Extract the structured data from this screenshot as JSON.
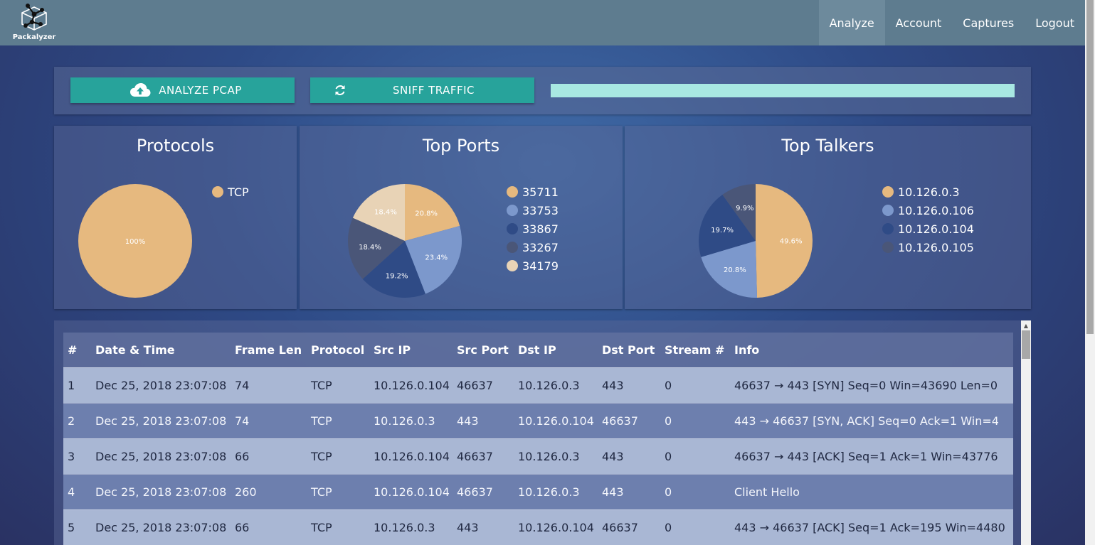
{
  "app": {
    "logo_text": "Packalyzer"
  },
  "nav": {
    "items": [
      {
        "label": "Analyze",
        "active": true
      },
      {
        "label": "Account"
      },
      {
        "label": "Captures"
      },
      {
        "label": "Logout"
      }
    ]
  },
  "actions": {
    "analyze_label": "ANALYZE PCAP",
    "analyze_icon": "cloud-upload-icon",
    "sniff_label": "SNIFF TRAFFIC",
    "sniff_icon": "refresh-icon",
    "progress": 1.0,
    "accent": "#27a39b"
  },
  "charts": {
    "protocols": {
      "title": "Protocols"
    },
    "ports": {
      "title": "Top Ports"
    },
    "talkers": {
      "title": "Top Talkers"
    }
  },
  "chart_data": [
    {
      "type": "pie",
      "title": "Protocols",
      "categories": [
        "TCP"
      ],
      "values": [
        100
      ],
      "labels": [
        "100%"
      ],
      "colors": [
        "#e6b97f"
      ],
      "legend": "right"
    },
    {
      "type": "pie",
      "title": "Top Ports",
      "categories": [
        "35711",
        "33753",
        "33867",
        "33267",
        "34179"
      ],
      "values": [
        20.8,
        23.4,
        19.2,
        18.4,
        18.4
      ],
      "labels": [
        "20.8%",
        "23.4%",
        "19.2%",
        "18.4%",
        "18.4%"
      ],
      "colors": [
        "#e6b97f",
        "#7c98cc",
        "#2f4b86",
        "#4a5678",
        "#e8d3b6"
      ],
      "legend": "right"
    },
    {
      "type": "pie",
      "title": "Top Talkers",
      "categories": [
        "10.126.0.3",
        "10.126.0.106",
        "10.126.0.104",
        "10.126.0.105"
      ],
      "values": [
        49.6,
        20.8,
        19.7,
        9.9
      ],
      "labels": [
        "49.6%",
        "20.8%",
        "19.7%",
        "9.9%"
      ],
      "colors": [
        "#e6b97f",
        "#7c98cc",
        "#2f4b86",
        "#4a5678"
      ],
      "legend": "right"
    }
  ],
  "table": {
    "columns": [
      "#",
      "Date & Time",
      "Frame Len",
      "Protocol",
      "Src IP",
      "Src Port",
      "Dst IP",
      "Dst Port",
      "Stream #",
      "Info"
    ],
    "rows": [
      [
        "1",
        "Dec 25, 2018 23:07:08",
        "74",
        "TCP",
        "10.126.0.104",
        "46637",
        "10.126.0.3",
        "443",
        "0",
        "46637 → 443 [SYN] Seq=0 Win=43690 Len=0"
      ],
      [
        "2",
        "Dec 25, 2018 23:07:08",
        "74",
        "TCP",
        "10.126.0.3",
        "443",
        "10.126.0.104",
        "46637",
        "0",
        "443 → 46637 [SYN, ACK] Seq=0 Ack=1 Win=4"
      ],
      [
        "3",
        "Dec 25, 2018 23:07:08",
        "66",
        "TCP",
        "10.126.0.104",
        "46637",
        "10.126.0.3",
        "443",
        "0",
        "46637 → 443 [ACK] Seq=1 Ack=1 Win=43776"
      ],
      [
        "4",
        "Dec 25, 2018 23:07:08",
        "260",
        "TCP",
        "10.126.0.104",
        "46637",
        "10.126.0.3",
        "443",
        "0",
        "Client Hello"
      ],
      [
        "5",
        "Dec 25, 2018 23:07:08",
        "66",
        "TCP",
        "10.126.0.3",
        "443",
        "10.126.0.104",
        "46637",
        "0",
        "443 → 46637 [ACK] Seq=1 Ack=195 Win=4480"
      ]
    ]
  }
}
